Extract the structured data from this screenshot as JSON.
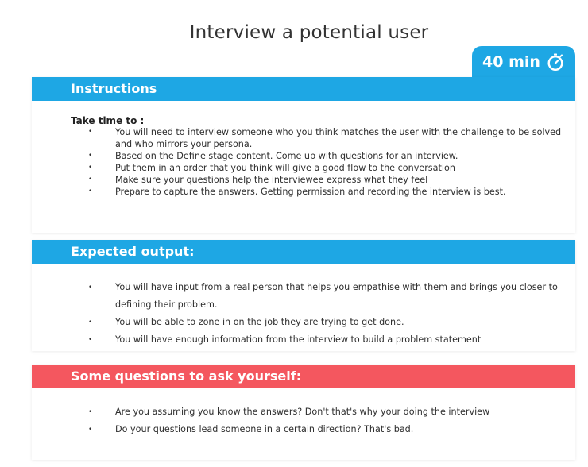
{
  "title": "Interview a potential user",
  "timer": {
    "label": "40 min",
    "icon": "stopwatch-icon",
    "color": "#1ea7e4"
  },
  "instructions": {
    "heading": "Instructions",
    "intro": "Take time to :",
    "items": [
      "You will need to interview someone who you think matches the user with the challenge to be solved and who mirrors your persona.",
      "Based on the Define stage content.  Come up with questions for an interview.",
      "Put them in an order that you think will give a good flow to the conversation",
      "Make sure your questions help the interviewee express what they feel",
      "Prepare to capture the answers.  Getting permission and recording the interview is best."
    ]
  },
  "expected": {
    "heading": "Expected output:",
    "items": [
      "You will have input from a real person that helps you empathise with them and brings you closer to defining their problem.",
      "You will be able to zone in on the job they are trying to get done.",
      "You will have enough information from the interview to build a problem statement"
    ]
  },
  "questions": {
    "heading": "Some questions to ask yourself:",
    "accent_color": "#f4575f",
    "items": [
      "Are you assuming you know the answers? Don't that's why your doing the interview",
      "Do your questions lead someone in a certain direction?  That's bad."
    ]
  }
}
